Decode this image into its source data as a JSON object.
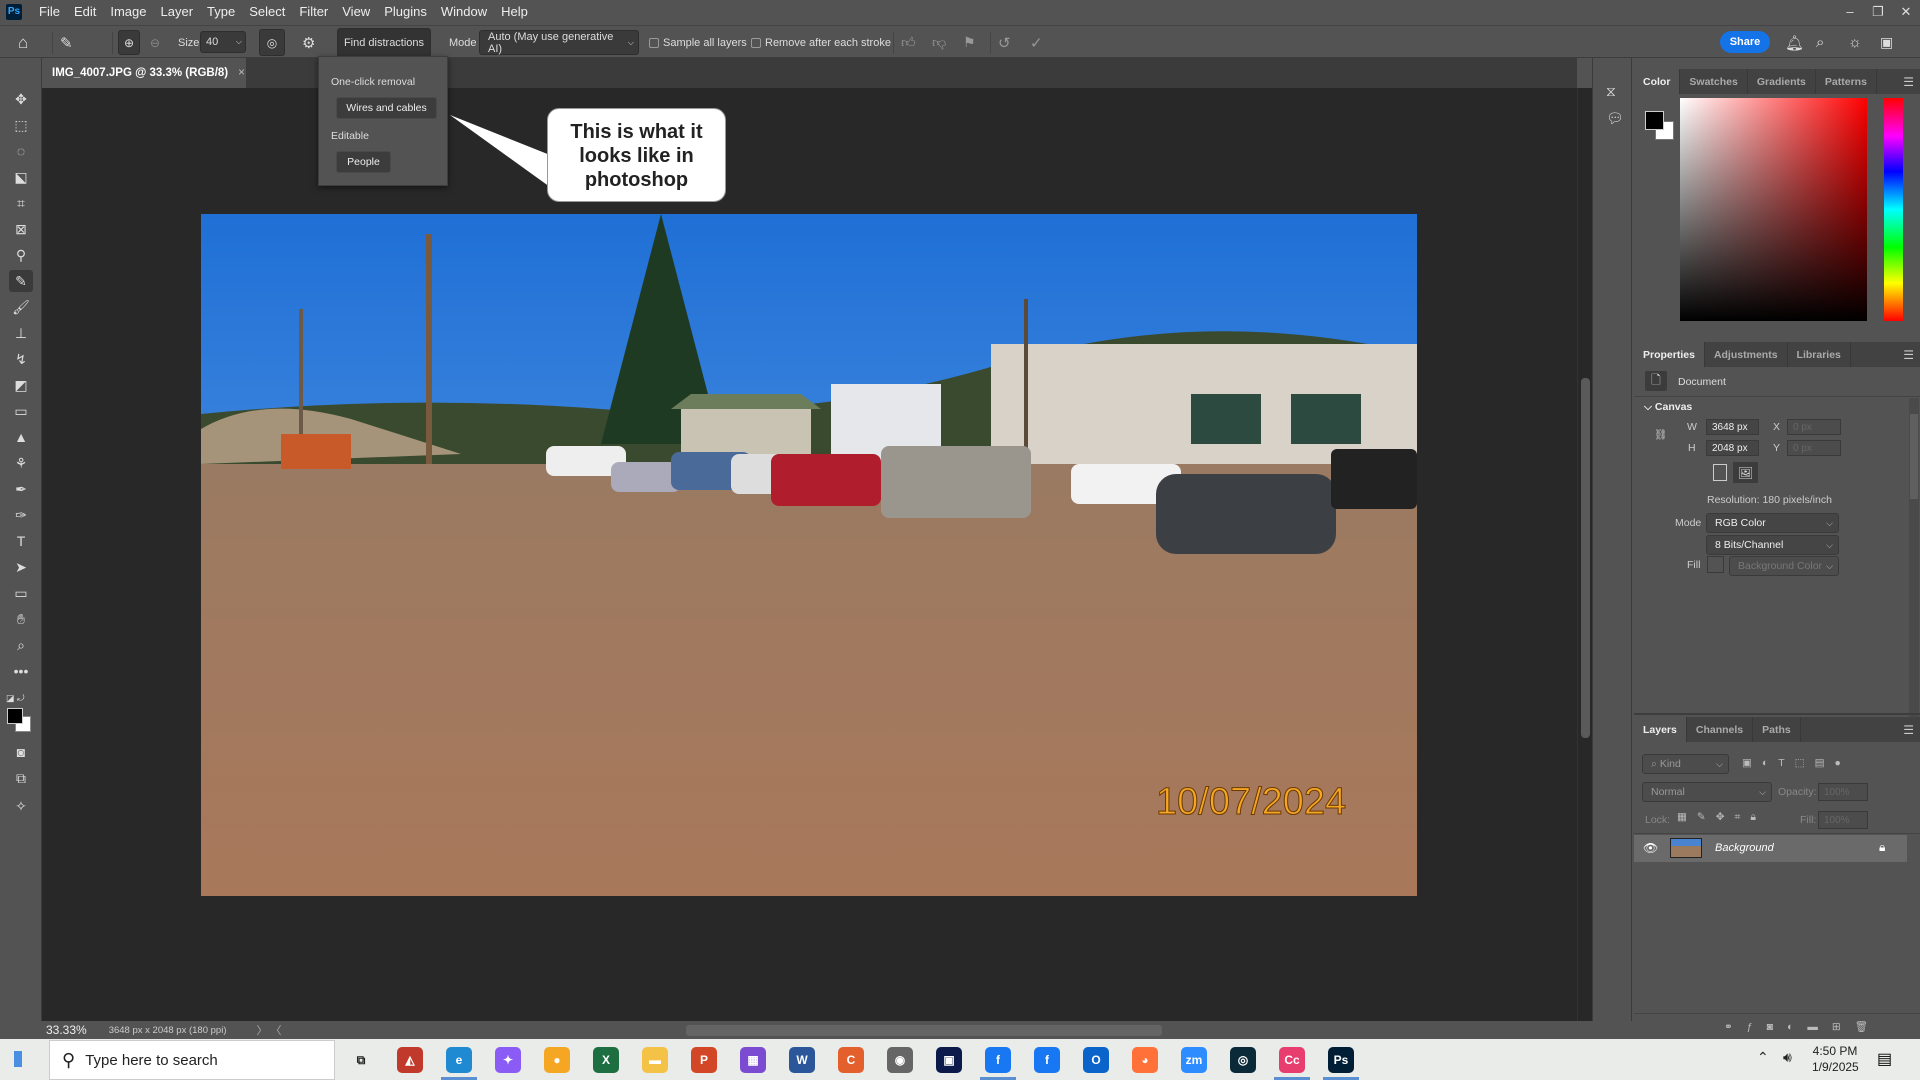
{
  "app": {
    "logo": "Ps",
    "menu": [
      "File",
      "Edit",
      "Image",
      "Layer",
      "Type",
      "Select",
      "Filter",
      "View",
      "Plugins",
      "Window",
      "Help"
    ]
  },
  "options": {
    "size_label": "Size",
    "size_value": "40",
    "find_distractions": "Find distractions",
    "mode_label": "Mode",
    "mode_value": "Auto (May use generative AI)",
    "sample_all_layers": "Sample all layers",
    "remove_after_stroke": "Remove after each stroke",
    "share": "Share"
  },
  "document_tab": {
    "title": "IMG_4007.JPG @ 33.3% (RGB/8)",
    "close": "×"
  },
  "popup": {
    "section1": "One-click removal",
    "btn1": "Wires and cables",
    "section2": "Editable",
    "btn2": "People"
  },
  "callout": {
    "text": "This is what it looks like in photoshop"
  },
  "photo": {
    "date_stamp": "10/07/2024"
  },
  "color_panel": {
    "tabs": [
      "Color",
      "Swatches",
      "Gradients",
      "Patterns"
    ],
    "foreground": "#000000",
    "background": "#ffffff",
    "hue": "#ff0000"
  },
  "properties": {
    "tabs": [
      "Properties",
      "Adjustments",
      "Libraries"
    ],
    "document_label": "Document",
    "canvas_label": "Canvas",
    "w_label": "W",
    "w_value": "3648 px",
    "h_label": "H",
    "h_value": "2048 px",
    "x_label": "X",
    "x_value": "0 px",
    "y_label": "Y",
    "y_value": "0 px",
    "resolution": "Resolution: 180 pixels/inch",
    "mode_label": "Mode",
    "mode_value": "RGB Color",
    "bits_value": "8 Bits/Channel",
    "fill_label": "Fill",
    "fill_value": "Background Color"
  },
  "layers": {
    "tabs": [
      "Layers",
      "Channels",
      "Paths"
    ],
    "kind_placeholder": "Kind",
    "blend_mode": "Normal",
    "opacity_label": "Opacity:",
    "opacity_value": "100%",
    "lock_label": "Lock:",
    "fill_label": "Fill:",
    "fill_value": "100%",
    "items": [
      {
        "name": "Background",
        "visible": true,
        "locked": true
      }
    ]
  },
  "status": {
    "zoom": "33.33%",
    "doc_info": "3648 px x 2048 px (180 ppi)"
  },
  "taskbar": {
    "search_placeholder": "Type here to search",
    "time": "4:50 PM",
    "date": "1/9/2025",
    "apps": [
      {
        "name": "task-view",
        "glyph": "⧉",
        "color": "#e9ece8"
      },
      {
        "name": "app-red-green",
        "glyph": "◭",
        "color": "#c0392b"
      },
      {
        "name": "edge",
        "glyph": "e",
        "color": "#1f8ad2"
      },
      {
        "name": "copilot",
        "glyph": "✦",
        "color": "#8a5cf5"
      },
      {
        "name": "orange-app",
        "glyph": "●",
        "color": "#f5a623"
      },
      {
        "name": "excel",
        "glyph": "X",
        "color": "#1d6f42"
      },
      {
        "name": "file-explorer",
        "glyph": "▬",
        "color": "#f3c246"
      },
      {
        "name": "powerpoint",
        "glyph": "P",
        "color": "#d24726"
      },
      {
        "name": "puzzle-app",
        "glyph": "▦",
        "color": "#7b4bd1"
      },
      {
        "name": "word",
        "glyph": "W",
        "color": "#2b579a"
      },
      {
        "name": "ccleaner",
        "glyph": "C",
        "color": "#e35f2c"
      },
      {
        "name": "grey-app",
        "glyph": "◉",
        "color": "#666666"
      },
      {
        "name": "dark-app",
        "glyph": "▣",
        "color": "#0b1a4a"
      },
      {
        "name": "facebook",
        "glyph": "f",
        "color": "#1877f2"
      },
      {
        "name": "facebook-2",
        "glyph": "f",
        "color": "#1877f2"
      },
      {
        "name": "outlook",
        "glyph": "O",
        "color": "#0a64c9"
      },
      {
        "name": "firefox",
        "glyph": "◕",
        "color": "#ff7139"
      },
      {
        "name": "zoom",
        "glyph": "zm",
        "color": "#2d8cff"
      },
      {
        "name": "camera-raw",
        "glyph": "◎",
        "color": "#0a2a3a"
      },
      {
        "name": "creative-cloud",
        "glyph": "Cc",
        "color": "#e83d6f"
      },
      {
        "name": "photoshop",
        "glyph": "Ps",
        "color": "#001e36"
      }
    ]
  }
}
